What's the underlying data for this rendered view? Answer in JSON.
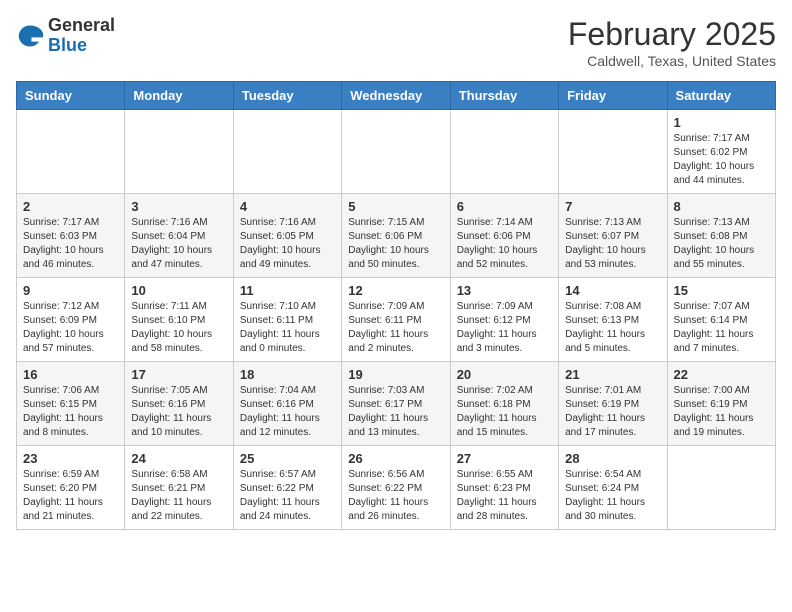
{
  "header": {
    "logo_general": "General",
    "logo_blue": "Blue",
    "month_year": "February 2025",
    "location": "Caldwell, Texas, United States"
  },
  "days_of_week": [
    "Sunday",
    "Monday",
    "Tuesday",
    "Wednesday",
    "Thursday",
    "Friday",
    "Saturday"
  ],
  "weeks": [
    [
      {
        "day": "",
        "info": ""
      },
      {
        "day": "",
        "info": ""
      },
      {
        "day": "",
        "info": ""
      },
      {
        "day": "",
        "info": ""
      },
      {
        "day": "",
        "info": ""
      },
      {
        "day": "",
        "info": ""
      },
      {
        "day": "1",
        "info": "Sunrise: 7:17 AM\nSunset: 6:02 PM\nDaylight: 10 hours\nand 44 minutes."
      }
    ],
    [
      {
        "day": "2",
        "info": "Sunrise: 7:17 AM\nSunset: 6:03 PM\nDaylight: 10 hours\nand 46 minutes."
      },
      {
        "day": "3",
        "info": "Sunrise: 7:16 AM\nSunset: 6:04 PM\nDaylight: 10 hours\nand 47 minutes."
      },
      {
        "day": "4",
        "info": "Sunrise: 7:16 AM\nSunset: 6:05 PM\nDaylight: 10 hours\nand 49 minutes."
      },
      {
        "day": "5",
        "info": "Sunrise: 7:15 AM\nSunset: 6:06 PM\nDaylight: 10 hours\nand 50 minutes."
      },
      {
        "day": "6",
        "info": "Sunrise: 7:14 AM\nSunset: 6:06 PM\nDaylight: 10 hours\nand 52 minutes."
      },
      {
        "day": "7",
        "info": "Sunrise: 7:13 AM\nSunset: 6:07 PM\nDaylight: 10 hours\nand 53 minutes."
      },
      {
        "day": "8",
        "info": "Sunrise: 7:13 AM\nSunset: 6:08 PM\nDaylight: 10 hours\nand 55 minutes."
      }
    ],
    [
      {
        "day": "9",
        "info": "Sunrise: 7:12 AM\nSunset: 6:09 PM\nDaylight: 10 hours\nand 57 minutes."
      },
      {
        "day": "10",
        "info": "Sunrise: 7:11 AM\nSunset: 6:10 PM\nDaylight: 10 hours\nand 58 minutes."
      },
      {
        "day": "11",
        "info": "Sunrise: 7:10 AM\nSunset: 6:11 PM\nDaylight: 11 hours\nand 0 minutes."
      },
      {
        "day": "12",
        "info": "Sunrise: 7:09 AM\nSunset: 6:11 PM\nDaylight: 11 hours\nand 2 minutes."
      },
      {
        "day": "13",
        "info": "Sunrise: 7:09 AM\nSunset: 6:12 PM\nDaylight: 11 hours\nand 3 minutes."
      },
      {
        "day": "14",
        "info": "Sunrise: 7:08 AM\nSunset: 6:13 PM\nDaylight: 11 hours\nand 5 minutes."
      },
      {
        "day": "15",
        "info": "Sunrise: 7:07 AM\nSunset: 6:14 PM\nDaylight: 11 hours\nand 7 minutes."
      }
    ],
    [
      {
        "day": "16",
        "info": "Sunrise: 7:06 AM\nSunset: 6:15 PM\nDaylight: 11 hours\nand 8 minutes."
      },
      {
        "day": "17",
        "info": "Sunrise: 7:05 AM\nSunset: 6:16 PM\nDaylight: 11 hours\nand 10 minutes."
      },
      {
        "day": "18",
        "info": "Sunrise: 7:04 AM\nSunset: 6:16 PM\nDaylight: 11 hours\nand 12 minutes."
      },
      {
        "day": "19",
        "info": "Sunrise: 7:03 AM\nSunset: 6:17 PM\nDaylight: 11 hours\nand 13 minutes."
      },
      {
        "day": "20",
        "info": "Sunrise: 7:02 AM\nSunset: 6:18 PM\nDaylight: 11 hours\nand 15 minutes."
      },
      {
        "day": "21",
        "info": "Sunrise: 7:01 AM\nSunset: 6:19 PM\nDaylight: 11 hours\nand 17 minutes."
      },
      {
        "day": "22",
        "info": "Sunrise: 7:00 AM\nSunset: 6:19 PM\nDaylight: 11 hours\nand 19 minutes."
      }
    ],
    [
      {
        "day": "23",
        "info": "Sunrise: 6:59 AM\nSunset: 6:20 PM\nDaylight: 11 hours\nand 21 minutes."
      },
      {
        "day": "24",
        "info": "Sunrise: 6:58 AM\nSunset: 6:21 PM\nDaylight: 11 hours\nand 22 minutes."
      },
      {
        "day": "25",
        "info": "Sunrise: 6:57 AM\nSunset: 6:22 PM\nDaylight: 11 hours\nand 24 minutes."
      },
      {
        "day": "26",
        "info": "Sunrise: 6:56 AM\nSunset: 6:22 PM\nDaylight: 11 hours\nand 26 minutes."
      },
      {
        "day": "27",
        "info": "Sunrise: 6:55 AM\nSunset: 6:23 PM\nDaylight: 11 hours\nand 28 minutes."
      },
      {
        "day": "28",
        "info": "Sunrise: 6:54 AM\nSunset: 6:24 PM\nDaylight: 11 hours\nand 30 minutes."
      },
      {
        "day": "",
        "info": ""
      }
    ]
  ]
}
